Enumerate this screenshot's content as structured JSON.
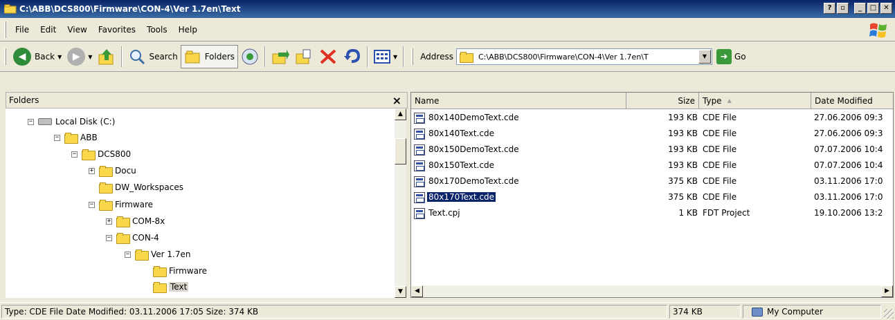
{
  "window": {
    "title": "C:\\ABB\\DCS800\\Firmware\\CON-4\\Ver 1.7en\\Text",
    "help_button_label": "?",
    "restore_button_label": "▫",
    "minimize_button_label": "_",
    "maximize_button_label": "□",
    "close_button_label": "✕"
  },
  "menubar": {
    "items": [
      {
        "label": "File"
      },
      {
        "label": "Edit"
      },
      {
        "label": "View"
      },
      {
        "label": "Favorites"
      },
      {
        "label": "Tools"
      },
      {
        "label": "Help"
      }
    ]
  },
  "toolbar": {
    "back_label": "Back",
    "search_label": "Search",
    "folders_label": "Folders",
    "address_label": "Address",
    "address_value": "C:\\ABB\\DCS800\\Firmware\\CON-4\\Ver 1.7en\\T",
    "go_label": "Go",
    "colors": {
      "back": "#2e8b3a",
      "forward": "#b0b0b0",
      "delete": "#e03020"
    }
  },
  "folders_pane": {
    "title": "Folders",
    "close_label": "×",
    "tree": [
      {
        "label": "Local Disk (C:)",
        "expander": "−",
        "kind": "disk"
      },
      {
        "label": "ABB",
        "expander": "−",
        "kind": "folder"
      },
      {
        "label": "DCS800",
        "expander": "−",
        "kind": "folder"
      },
      {
        "label": "Docu",
        "expander": "+",
        "kind": "folder"
      },
      {
        "label": "DW_Workspaces",
        "expander": "",
        "kind": "folder"
      },
      {
        "label": "Firmware",
        "expander": "−",
        "kind": "folder"
      },
      {
        "label": "COM-8x",
        "expander": "+",
        "kind": "folder"
      },
      {
        "label": "CON-4",
        "expander": "−",
        "kind": "folder"
      },
      {
        "label": "Ver 1.7en",
        "expander": "−",
        "kind": "folder"
      },
      {
        "label": "Firmware",
        "expander": "",
        "kind": "folder"
      },
      {
        "label": "Text",
        "expander": "",
        "kind": "folder",
        "selected": true
      }
    ]
  },
  "file_list": {
    "columns": {
      "name": "Name",
      "size": "Size",
      "type": "Type",
      "date": "Date Modified"
    },
    "rows": [
      {
        "name": "80x140DemoText.cde",
        "size": "193 KB",
        "type": "CDE File",
        "date": "27.06.2006 09:3"
      },
      {
        "name": "80x140Text.cde",
        "size": "193 KB",
        "type": "CDE File",
        "date": "27.06.2006 09:3"
      },
      {
        "name": "80x150DemoText.cde",
        "size": "193 KB",
        "type": "CDE File",
        "date": "07.07.2006 10:4"
      },
      {
        "name": "80x150Text.cde",
        "size": "193 KB",
        "type": "CDE File",
        "date": "07.07.2006 10:4"
      },
      {
        "name": "80x170DemoText.cde",
        "size": "375 KB",
        "type": "CDE File",
        "date": "03.11.2006 17:0"
      },
      {
        "name": "80x170Text.cde",
        "size": "375 KB",
        "type": "CDE File",
        "date": "03.11.2006 17:0",
        "selected": true
      },
      {
        "name": "Text.cpj",
        "size": "1 KB",
        "type": "FDT Project",
        "date": "19.10.2006 13:2"
      }
    ]
  },
  "statusbar": {
    "info": "Type: CDE File Date Modified: 03.11.2006 17:05 Size: 374 KB",
    "size": "374 KB",
    "zone": "My Computer"
  }
}
